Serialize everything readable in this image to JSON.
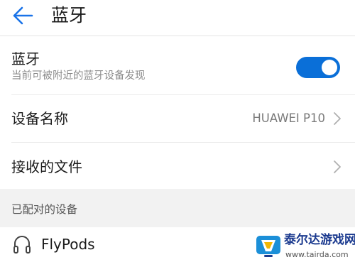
{
  "header": {
    "title": "蓝牙",
    "back_icon": "arrow-left-icon",
    "accent": "#1a73e8"
  },
  "bluetooth": {
    "label": "蓝牙",
    "subtitle": "当前可被附近的蓝牙设备发现",
    "enabled": true,
    "toggle_color": "#0a6fd8"
  },
  "device_name": {
    "label": "设备名称",
    "value": "HUAWEI P10",
    "chevron_icon": "chevron-right-icon"
  },
  "received_files": {
    "label": "接收的文件",
    "chevron_icon": "chevron-right-icon"
  },
  "paired_section": {
    "label": "已配对的设备",
    "devices": [
      {
        "name": "FlyPods",
        "icon": "headset-icon"
      }
    ]
  },
  "watermark": {
    "title": "泰尔达游戏网",
    "url": "www.tairda.com"
  }
}
